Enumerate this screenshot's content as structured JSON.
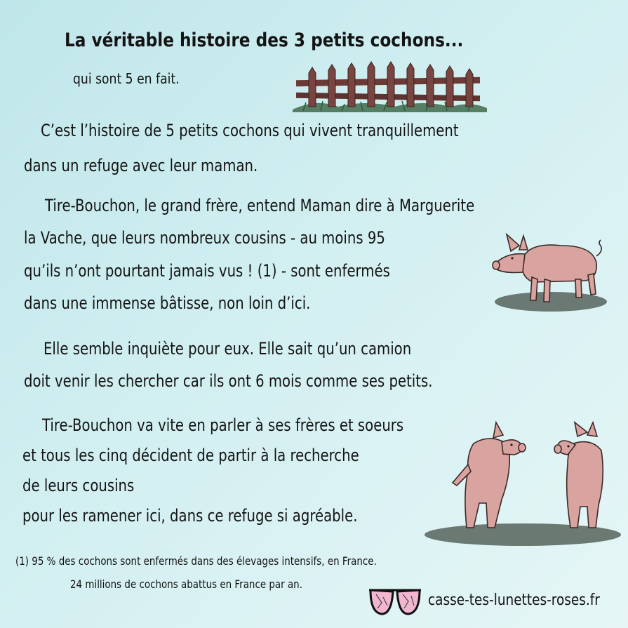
{
  "title": "La véritable histoire des 3 petits cochons...",
  "subtitle": "qui sont 5 en fait.",
  "paragraphs": [
    [
      "C’est l’histoire de 5 petits cochons qui vivent tranquillement",
      "dans un refuge avec leur maman."
    ],
    [
      "Tire-Bouchon, le grand frère, entend Maman dire à Marguerite",
      "la Vache, que leurs nombreux cousins - au moins 95",
      "qu’ils n’ont pourtant jamais vus ! (1) - sont enfermés",
      "dans une immense bâtisse, non loin d’ici."
    ],
    [
      "Elle semble inquiète pour eux. Elle sait qu’un camion",
      "doit venir les chercher car ils ont 6 mois comme ses petits."
    ],
    [
      "Tire-Bouchon va vite en parler à ses frères et soeurs",
      "et tous les cinq décident de partir à la recherche",
      "de leurs cousins",
      "pour les ramener ici, dans ce refuge si agréable."
    ]
  ],
  "footnote": {
    "line1": "(1)  95 % des cochons sont enfermés dans des élevages intensifs, en France.",
    "line2": "24 millions de cochons abattus en France par an."
  },
  "website": "casse-tes-lunettes-roses.fr",
  "illustrations": {
    "fence": "wooden-fence-illustration",
    "pig_standing": "standing-pig-illustration",
    "pigs_upright": "two-upright-pigs-illustration",
    "glasses": "broken-pink-glasses-logo"
  },
  "colors": {
    "pig": "#d9a3a0",
    "pig_outline": "#3a2a28",
    "fence": "#6b3a36",
    "grass": "#3f6b4b",
    "ground": "#4e5a52"
  }
}
